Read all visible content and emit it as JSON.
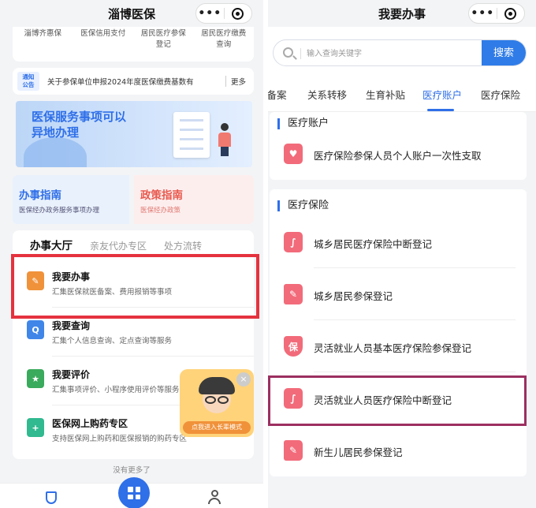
{
  "left": {
    "nav_title": "淄博医保",
    "capsule_more": "•••",
    "quick_links": [
      {
        "line1": "淄博齐惠保",
        "line2": ""
      },
      {
        "line1": "医保信用支付",
        "line2": ""
      },
      {
        "line1": "居民医疗参保",
        "line2": "登记"
      },
      {
        "line1": "居民医疗缴费",
        "line2": "查询"
      }
    ],
    "notice_badge_line1": "通知",
    "notice_badge_line2": "公告",
    "notice_text": "关于参保单位申报2024年度医保缴费基数有",
    "notice_more": "更多",
    "banner_line1": "医保服务事项可以",
    "banner_line2": "异地办理",
    "guide_left": {
      "title": "办事指南",
      "subtitle": "医保经办政务服务事项办理"
    },
    "guide_right": {
      "title": "政策指南",
      "subtitle": "医保经办政策"
    },
    "hall_tabs": [
      "办事大厅",
      "亲友代办专区",
      "处方流转"
    ],
    "services": [
      {
        "title": "我要办事",
        "desc": "汇集医保就医备案、费用报销等事项",
        "color": "#f0923a",
        "glyph": "✎"
      },
      {
        "title": "我要查询",
        "desc": "汇集个人信息查询、定点查询等服务",
        "color": "#3f86e8",
        "glyph": "Q"
      },
      {
        "title": "我要评价",
        "desc": "汇集事项评价、小程序使用评价等服务",
        "color": "#3aaa5c",
        "glyph": "★"
      },
      {
        "title": "医保网上购药专区",
        "desc": "支持医保网上购药和医保报销的购药专区",
        "color": "#31b98f",
        "glyph": "+"
      }
    ],
    "float_label": "点我进入长辈模式",
    "close_glyph": "×",
    "no_more": "没有更多了"
  },
  "right": {
    "nav_title": "我要办事",
    "capsule_more": "•••",
    "search_placeholder": "输入查询关键字",
    "search_button": "搜索",
    "cat_tabs": [
      "医备案",
      "关系转移",
      "生育补贴",
      "医疗账户",
      "医疗保险"
    ],
    "active_cat_index": 3,
    "section_account": {
      "title": "医疗账户",
      "items": [
        {
          "label": "医疗保险参保人员个人账户一次性支取",
          "icon": "heart-icon",
          "glyph": "♥"
        }
      ]
    },
    "section_insurance": {
      "title": "医疗保险",
      "items": [
        {
          "label": "城乡居民医疗保险中断登记",
          "icon": "stethoscope-icon",
          "glyph": "∫"
        },
        {
          "label": "城乡居民参保登记",
          "icon": "notebook-icon",
          "glyph": "✎"
        },
        {
          "label": "灵活就业人员基本医疗保险参保登记",
          "icon": "shield-icon",
          "glyph": "保"
        },
        {
          "label": "灵活就业人员医疗保险中断登记",
          "icon": "stethoscope-icon",
          "glyph": "∫"
        },
        {
          "label": "新生儿居民参保登记",
          "icon": "notebook-icon",
          "glyph": "✎"
        }
      ]
    }
  },
  "colors": {
    "primary": "#2f6fe8",
    "highlight_left": "#e5323e",
    "highlight_right": "#9c2f60",
    "icon_pink": "#f26b7a"
  }
}
